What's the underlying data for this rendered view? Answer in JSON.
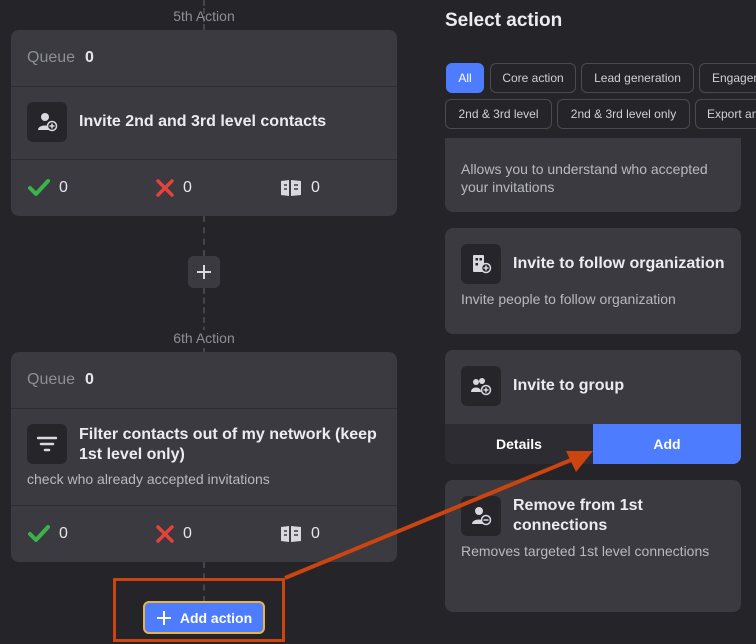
{
  "left": {
    "step5": {
      "label": "5th Action",
      "queue_label": "Queue",
      "queue_value": "0",
      "title": "Invite 2nd and 3rd level contacts",
      "icon": "user-plus-icon",
      "stats": {
        "success": "0",
        "failed": "0",
        "skipped": "0"
      }
    },
    "step6": {
      "label": "6th Action",
      "queue_label": "Queue",
      "queue_value": "0",
      "title_line1": "Filter contacts out of my network (keep",
      "title_line2": "1st level only)",
      "desc": "check who already accepted invitations",
      "icon": "filter-icon",
      "stats": {
        "success": "0",
        "failed": "0",
        "skipped": "0"
      }
    },
    "add_action_label": "Add action"
  },
  "right": {
    "title": "Select action",
    "filters_row1": [
      "All",
      "Core action",
      "Lead generation",
      "Engagement"
    ],
    "filters_row2": [
      "2nd & 3rd level",
      "2nd & 3rd level only",
      "Export and"
    ],
    "active_filter": "All",
    "cards": [
      {
        "desc_line1": "Allows you to understand who accepted",
        "desc_line2": "your invitations"
      },
      {
        "title": "Invite to follow organization",
        "desc": "Invite people to follow organization",
        "icon": "building-plus-icon"
      },
      {
        "title": "Invite to group",
        "icon": "group-plus-icon",
        "details_label": "Details",
        "add_label": "Add"
      },
      {
        "title_line1": "Remove from 1st",
        "title_line2": "connections",
        "desc": "Removes targeted 1st level connections",
        "icon": "user-minus-icon"
      }
    ]
  },
  "colors": {
    "background": "#252529",
    "card": "#3a3a40",
    "accent": "#4d7cfe",
    "annotation": "#cc4410",
    "success": "#3bb24a",
    "error": "#e2443a"
  }
}
